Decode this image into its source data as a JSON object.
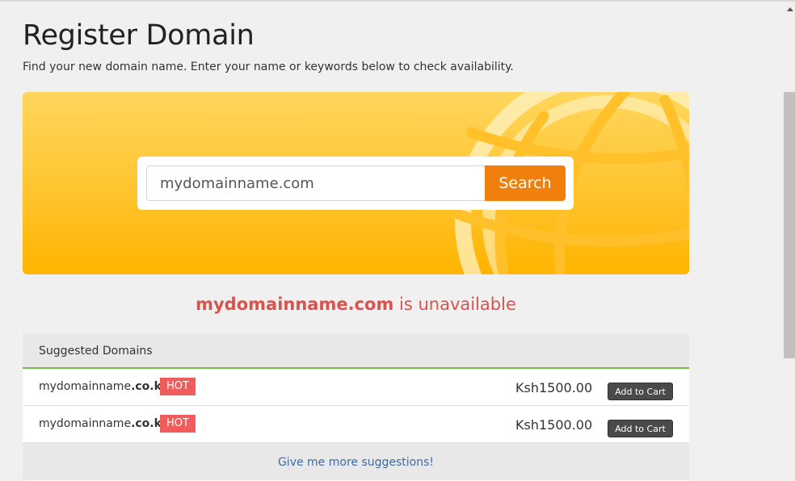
{
  "page": {
    "title": "Register Domain",
    "subtitle": "Find your new domain name. Enter your name or keywords below to check availability."
  },
  "search": {
    "value": "mydomainname.com",
    "button_label": "Search"
  },
  "result": {
    "domain": "mydomainname.com",
    "status_text": "is unavailable"
  },
  "suggestions": {
    "heading": "Suggested Domains",
    "rows": [
      {
        "name": "mydomainname",
        "tld": ".co.ke",
        "badge": "HOT",
        "price": "Ksh1500.00",
        "button_label": "Add to Cart"
      },
      {
        "name": "mydomainname",
        "tld": ".co.ke",
        "badge": "HOT",
        "price": "Ksh1500.00",
        "button_label": "Add to Cart"
      }
    ],
    "more_link": "Give me more suggestions!"
  },
  "colors": {
    "accent_orange": "#f07f0c",
    "banner_yellow": "#ffc42e",
    "unavailable_red": "#d9534f",
    "hot_badge": "#ef5c5c",
    "link_blue": "#3d6aa8",
    "divider_green": "#6cc04a"
  },
  "icons": {
    "banner_art": "globe-icon",
    "scroll_up": "chevron-up-icon"
  }
}
